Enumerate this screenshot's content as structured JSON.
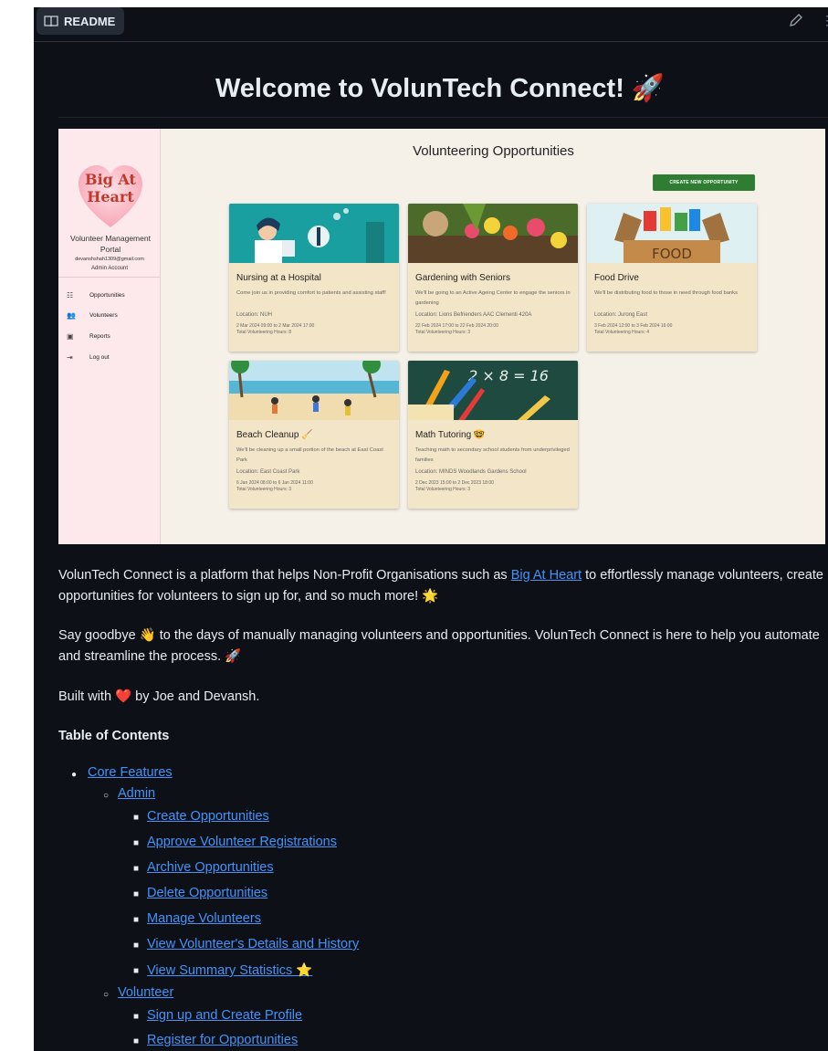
{
  "tab": {
    "label": "README"
  },
  "readme": {
    "title": "Welcome to VolunTech Connect! 🚀",
    "intro_prefix": "VolunTech Connect is a platform that helps Non-Profit Organisations such as ",
    "intro_link": "Big At Heart",
    "intro_suffix": " to effortlessly manage volunteers, create opportunities for volunteers to sign up for, and so much more! 🌟",
    "goodbye": "Say goodbye 👋 to the days of manually managing volunteers and opportunities. VolunTech Connect is here to help you automate and streamline the process. 🚀",
    "built": "Built with ❤️ by Joe and Devansh.",
    "toc_heading": "Table of Contents",
    "toc": {
      "core": "Core Features",
      "admin": "Admin",
      "admin_items": [
        "Create Opportunities",
        "Approve Volunteer Registrations",
        "Archive Opportunities",
        "Delete Opportunities",
        "Manage Volunteers",
        "View Volunteer's Details and History",
        "View Summary Statistics ⭐"
      ],
      "volunteer": "Volunteer",
      "volunteer_items": [
        "Sign up and Create Profile",
        "Register for Opportunities"
      ]
    }
  },
  "app": {
    "logo_text": "Big At Heart",
    "portal_title": "Volunteer Management Portal",
    "email": "devanshshah1309@gmail.com",
    "account": "Admin Account",
    "nav": [
      {
        "label": "Opportunities",
        "icon": "list-icon"
      },
      {
        "label": "Volunteers",
        "icon": "people-icon"
      },
      {
        "label": "Reports",
        "icon": "report-icon"
      },
      {
        "label": "Log out",
        "icon": "logout-icon"
      }
    ],
    "page_title": "Volunteering Opportunities",
    "create_button": "CREATE NEW OPPORTUNITY",
    "cards": [
      {
        "title": "Nursing at a Hospital",
        "desc": "Come join us in providing comfort to patients and assisting staff!",
        "location": "Location: NUH",
        "date": "2 Mar 2024 09:00 to 2 Mar 2024 17:00",
        "hours": "Total Volunteering Hours: 8",
        "image": "nurse-illustration"
      },
      {
        "title": "Gardening with Seniors",
        "desc": "We'll be going to an Active Ageing Center to engage the seniors in gardening",
        "location": "Location: Lions Befrienders AAC Clementi 420A",
        "date": "22 Feb 2024 17:00 to 22 Feb 2024 20:00",
        "hours": "Total Volunteering Hours: 3",
        "image": "garden-photo"
      },
      {
        "title": "Food Drive",
        "desc": "We'll be distributing food to those in need through food banks",
        "location": "Location: Jurong East",
        "date": "3 Feb 2024 12:00 to 3 Feb 2024 16:00",
        "hours": "Total Volunteering Hours: 4",
        "image": "food-box-illustration",
        "image_text": "FOOD"
      },
      {
        "title": "Beach Cleanup 🧹",
        "desc": "We'll be cleaning up a small portion of the beach at East Coast Park",
        "location": "Location: East Coast Park",
        "date": "6 Jan 2024 08:00 to 6 Jan 2024 11:00",
        "hours": "Total Volunteering Hours: 3",
        "image": "beach-illustration"
      },
      {
        "title": "Math Tutoring 🤓",
        "desc": "Teaching math to secondary school students from underprivileged families",
        "location": "Location: MINDS Woodlands Gardens School",
        "date": "2 Dec 2023 15:00 to 2 Dec 2023 18:00",
        "hours": "Total Volunteering Hours: 3",
        "image": "math-chalkboard-photo",
        "image_text": "2 × 8 = 16"
      }
    ]
  }
}
